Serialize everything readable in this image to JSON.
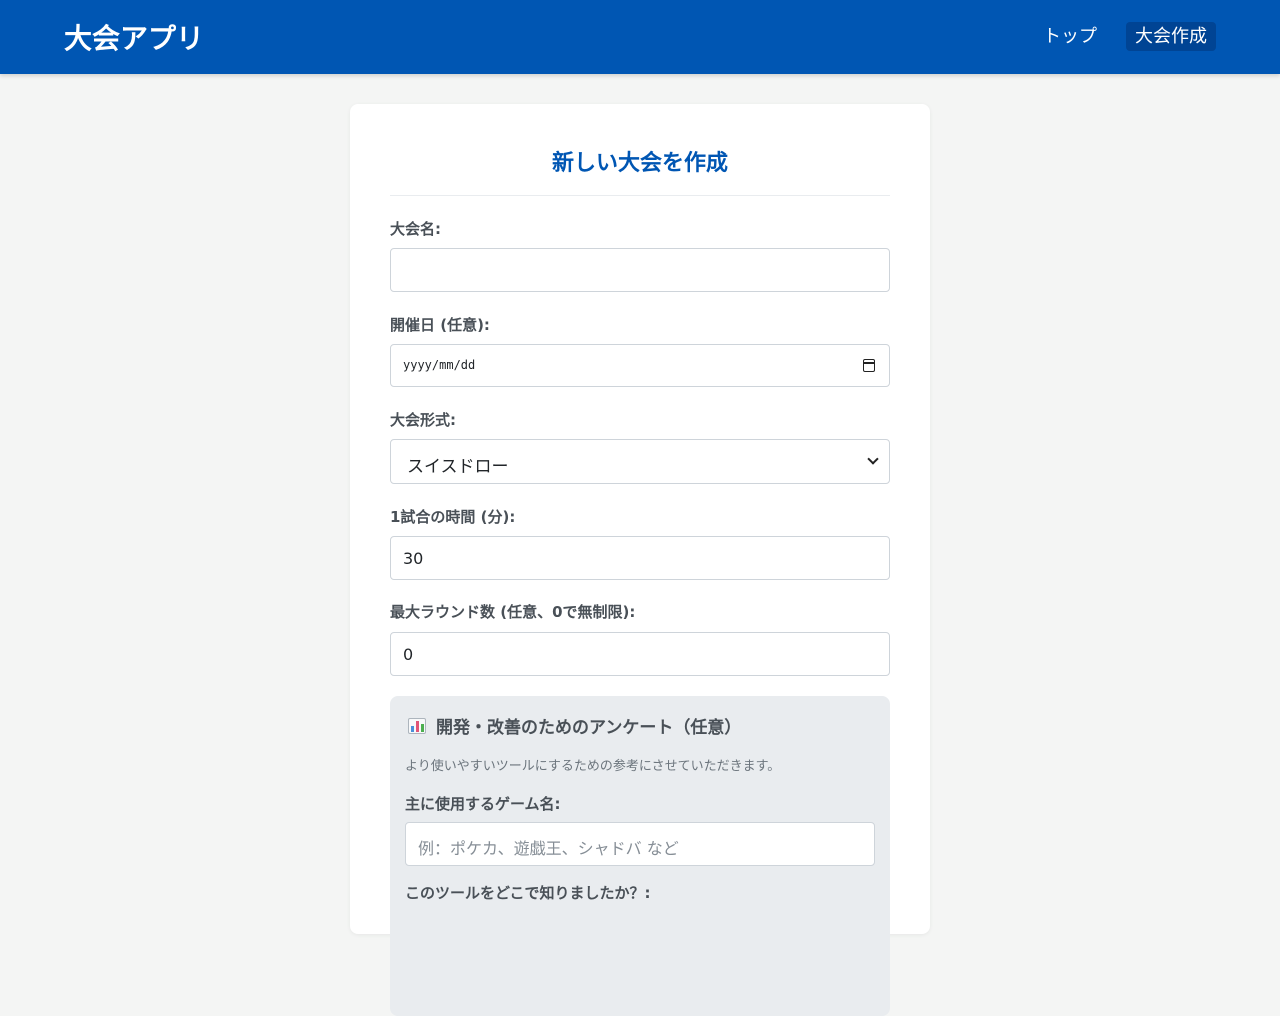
{
  "header": {
    "brand": "大会アプリ",
    "nav": {
      "top": "トップ",
      "create": "大会作成"
    },
    "background_color": "#0056b3"
  },
  "form": {
    "title": "新しい大会を作成",
    "fields": {
      "name": {
        "label": "大会名:",
        "value": ""
      },
      "date": {
        "label": "開催日 (任意):",
        "value": "yyyy/mm/dd"
      },
      "format": {
        "label": "大会形式:",
        "selected": "スイスドロー"
      },
      "match_time": {
        "label": "1試合の時間 (分):",
        "value": "30"
      },
      "max_rounds": {
        "label": "最大ラウンド数 (任意、0で無制限):",
        "value": "0"
      }
    }
  },
  "survey": {
    "icon": "bar-chart-icon",
    "heading": "開発・改善のためのアンケート（任意）",
    "description": "より使いやすいツールにするための参考にさせていただきます。",
    "game_name": {
      "label": "主に使用するゲーム名:",
      "placeholder": "例：ポケカ、遊戯王、シャドバ など"
    },
    "discovery": {
      "label": "このツールをどこで知りましたか？:"
    }
  }
}
